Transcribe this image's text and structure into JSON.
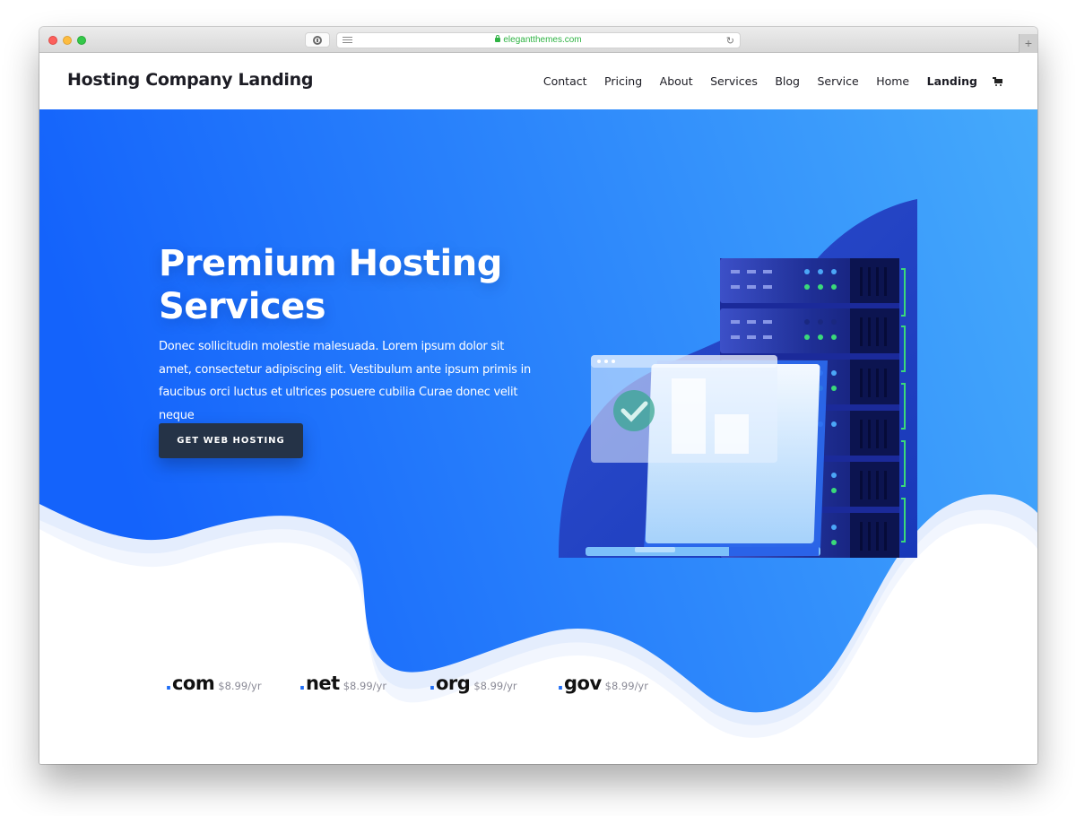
{
  "browser": {
    "url": "elegantthemes.com",
    "new_tab_label": "+",
    "reload_glyph": "↻"
  },
  "site": {
    "title": "Hosting Company Landing",
    "nav": [
      {
        "label": "Contact",
        "active": false
      },
      {
        "label": "Pricing",
        "active": false
      },
      {
        "label": "About",
        "active": false
      },
      {
        "label": "Services",
        "active": false
      },
      {
        "label": "Blog",
        "active": false
      },
      {
        "label": "Service",
        "active": false
      },
      {
        "label": "Home",
        "active": false
      },
      {
        "label": "Landing",
        "active": true
      }
    ],
    "cart_icon": "shopping-cart-icon"
  },
  "hero": {
    "title": "Premium Hosting Services",
    "description": "Donec sollicitudin molestie malesuada. Lorem ipsum dolor sit amet, consectetur adipiscing elit. Vestibulum ante ipsum primis in faucibus orci luctus et ultrices posuere cubilia Curae donec velit neque",
    "cta_label": "GET WEB HOSTING",
    "illustration": "server-rack-laptop-illustration"
  },
  "domains": [
    {
      "tld": "com",
      "price": "$8.99/yr"
    },
    {
      "tld": "net",
      "price": "$8.99/yr"
    },
    {
      "tld": "org",
      "price": "$8.99/yr"
    },
    {
      "tld": "gov",
      "price": "$8.99/yr"
    }
  ],
  "colors": {
    "hero_start": "#1463fb",
    "hero_end": "#44a9fb",
    "accent": "#1e6df6",
    "cta_bg": "#253347",
    "url_green": "#2fb344"
  }
}
